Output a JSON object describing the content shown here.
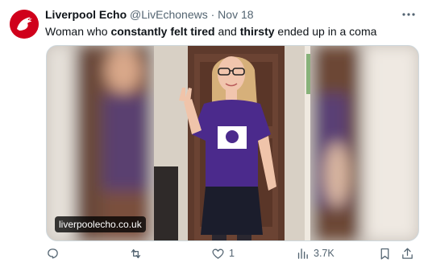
{
  "tweet": {
    "author_name": "Liverpool Echo",
    "handle": "@LivEchonews",
    "separator": "·",
    "date": "Nov 18",
    "text_parts": [
      {
        "text": "Woman who ",
        "bold": false
      },
      {
        "text": "constantly felt tired",
        "bold": true
      },
      {
        "text": " and ",
        "bold": false
      },
      {
        "text": "thirsty",
        "bold": true
      },
      {
        "text": " ended up in a coma",
        "bold": false
      }
    ],
    "media_link_caption": "liverpoolecho.co.uk"
  },
  "actions": {
    "reply": {
      "icon": "reply-icon",
      "count": ""
    },
    "retweet": {
      "icon": "retweet-icon",
      "count": ""
    },
    "like": {
      "icon": "heart-icon",
      "count": "1"
    },
    "views": {
      "icon": "views-icon",
      "count": "3.7K"
    },
    "bookmark": {
      "icon": "bookmark-icon"
    },
    "share": {
      "icon": "share-icon"
    }
  },
  "colors": {
    "brand_red": "#d0001b",
    "muted_text": "#536471",
    "shirt_purple": "#4b2a8c"
  }
}
